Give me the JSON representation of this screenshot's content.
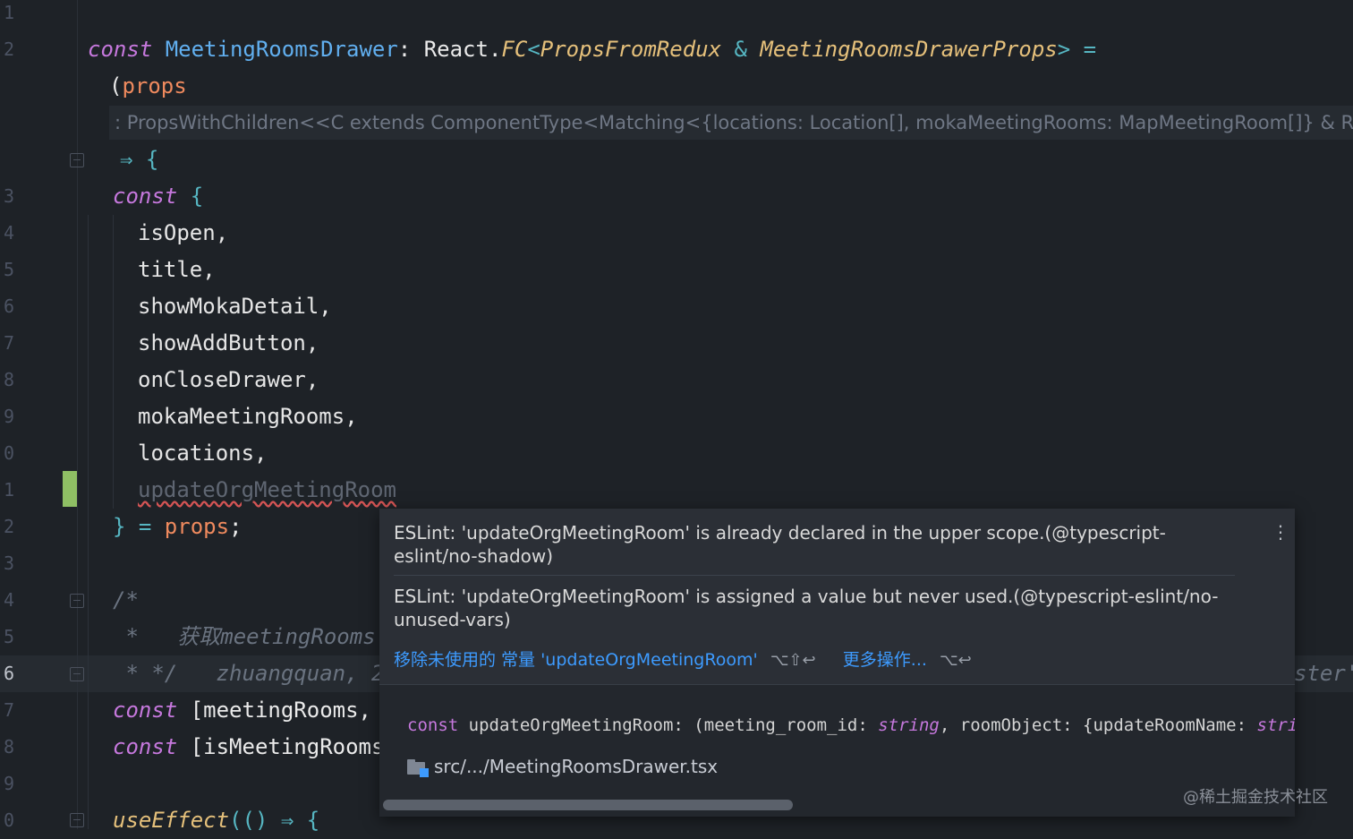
{
  "editor": {
    "line_numbers": [
      "1",
      "2",
      "",
      "",
      "3",
      "4",
      "5",
      "6",
      "7",
      "8",
      "9",
      "0",
      "1",
      "2",
      "3",
      "4",
      "5",
      "6",
      "7",
      "8",
      "9",
      "0"
    ],
    "line1": {
      "kw": "const",
      "name": "MeetingRoomsDrawer",
      "colon": ": ",
      "react": "React.",
      "fc": "FC",
      "lt": "<",
      "props_from_redux": "PropsFromRedux",
      "amp": " & ",
      "drawer_props": "MeetingRoomsDrawerProps",
      "gt": ">",
      "eq": " ="
    },
    "line2": {
      "paren": "(",
      "param": "props"
    },
    "type_hint": ": PropsWithChildren<<C extends ComponentType<Matching<{locations: Location[], mokaMeetingRooms: MapMeetingRoom[]} & R",
    "line_arrow": "⇒ {",
    "line_const": {
      "kw": "const",
      "brace": " {"
    },
    "destructure_items": [
      "isOpen,",
      "title,",
      "showMokaDetail,",
      "showAddButton,",
      "onCloseDrawer,",
      "mokaMeetingRooms,",
      "locations,"
    ],
    "unused_item": "updateOrgMeetingRoom",
    "line_close": {
      "brace": "} = ",
      "param": "props",
      "semi": ";"
    },
    "comment_open": "/*",
    "comment_line": " *   获取meetingRooms",
    "comment_close": " * */   zhuangquan, 2",
    "comment_overflow": "ster'",
    "line_meeting_rooms": {
      "kw": "const",
      "rest": " [meetingRooms,"
    },
    "line_is_meeting": {
      "kw": "const",
      "rest": " [isMeetingRooms"
    },
    "line_effect": {
      "fn": "useEffect",
      "rest": "(() ",
      "arrow": "⇒ {"
    }
  },
  "popup": {
    "message1": "ESLint: 'updateOrgMeetingRoom' is already declared in the upper scope.(@typescript-eslint/no-shadow)",
    "message2": "ESLint: 'updateOrgMeetingRoom' is assigned a value but never used.(@typescript-eslint/no-unused-vars)",
    "action_remove": "移除未使用的 常量 'updateOrgMeetingRoom'",
    "action_remove_shortcut": "⌥⇧↩",
    "action_more": "更多操作...",
    "action_more_shortcut": "⌥↩",
    "more_icon": "⋮",
    "declaration": {
      "kw": "const",
      "name": " updateOrgMeetingRoom: (",
      "p1": "meeting_room_id",
      "colon1": ": ",
      "t1": "string",
      "comma": ", ",
      "p2": "roomObject",
      "rest": ": {updateRoomName: ",
      "t2": "strin"
    },
    "file_path": "src/.../MeetingRoomsDrawer.tsx",
    "folder_icon": "folder-icon"
  },
  "watermark": "@稀土掘金技术社区",
  "colors": {
    "background": "#1e2227",
    "keyword": "#c678dd",
    "type": "#61afef",
    "generic": "#e5c07b",
    "param": "#ef8a5e",
    "link": "#3d9bff",
    "change_marker": "#8fbf64"
  }
}
